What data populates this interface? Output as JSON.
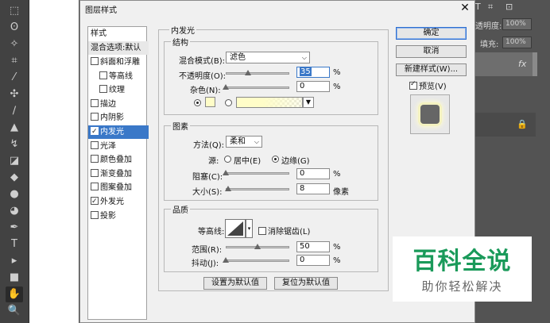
{
  "toolbar": {
    "tools": [
      {
        "name": "marquee-tool-icon",
        "glyph": "⬚"
      },
      {
        "name": "lasso-tool-icon",
        "glyph": "ʘ"
      },
      {
        "name": "magic-wand-tool-icon",
        "glyph": "✧"
      },
      {
        "name": "crop-tool-icon",
        "glyph": "⌗"
      },
      {
        "name": "eyedropper-tool-icon",
        "glyph": "⁄"
      },
      {
        "name": "healing-tool-icon",
        "glyph": "✣"
      },
      {
        "name": "brush-tool-icon",
        "glyph": "∕"
      },
      {
        "name": "stamp-tool-icon",
        "glyph": "▲"
      },
      {
        "name": "history-brush-tool-icon",
        "glyph": "↯"
      },
      {
        "name": "eraser-tool-icon",
        "glyph": "◪"
      },
      {
        "name": "paint-bucket-tool-icon",
        "glyph": "◆"
      },
      {
        "name": "blur-tool-icon",
        "glyph": "●"
      },
      {
        "name": "dodge-tool-icon",
        "glyph": "◕"
      },
      {
        "name": "pen-tool-icon",
        "glyph": "✒"
      },
      {
        "name": "type-tool-icon",
        "glyph": "T"
      },
      {
        "name": "path-select-tool-icon",
        "glyph": "▸"
      },
      {
        "name": "rectangle-tool-icon",
        "glyph": "■"
      },
      {
        "name": "hand-tool-icon",
        "glyph": "✋"
      },
      {
        "name": "zoom-tool-icon",
        "glyph": "🔍"
      }
    ]
  },
  "right_panel": {
    "opacity_label": "透明度:",
    "opacity_value": "100%",
    "fill_label": "填充:",
    "fill_value": "100%",
    "fx_label": "fx"
  },
  "dialog": {
    "title": "图层样式",
    "close": "✕",
    "style_list": {
      "header": "样式",
      "blend_options": "混合选项:默认",
      "items": [
        {
          "label": "斜面和浮雕",
          "checked": false,
          "indent": false
        },
        {
          "label": "等高线",
          "checked": false,
          "indent": true
        },
        {
          "label": "纹理",
          "checked": false,
          "indent": true
        },
        {
          "label": "描边",
          "checked": false,
          "indent": false
        },
        {
          "label": "内阴影",
          "checked": false,
          "indent": false
        },
        {
          "label": "内发光",
          "checked": true,
          "indent": false,
          "selected": true
        },
        {
          "label": "光泽",
          "checked": false,
          "indent": false
        },
        {
          "label": "颜色叠加",
          "checked": false,
          "indent": false
        },
        {
          "label": "渐变叠加",
          "checked": false,
          "indent": false
        },
        {
          "label": "图案叠加",
          "checked": false,
          "indent": false
        },
        {
          "label": "外发光",
          "checked": true,
          "indent": false
        },
        {
          "label": "投影",
          "checked": false,
          "indent": false
        }
      ]
    },
    "inner_glow": {
      "title": "内发光",
      "structure": {
        "title": "结构",
        "blend_mode_label": "混合模式(B):",
        "blend_mode_value": "滤色",
        "opacity_label": "不透明度(O):",
        "opacity_value": "35",
        "opacity_fraction": 0.35,
        "noise_label": "杂色(N):",
        "noise_value": "0",
        "noise_fraction": 0,
        "percent": "%",
        "glow_color": "#fffdc8"
      },
      "elements": {
        "title": "图素",
        "method_label": "方法(Q):",
        "method_value": "柔和",
        "source_label": "源:",
        "center_label": "居中(E)",
        "edge_label": "边缘(G)",
        "choke_label": "阻塞(C):",
        "choke_value": "0",
        "choke_fraction": 0,
        "size_label": "大小(S):",
        "size_value": "8",
        "size_fraction": 0.032,
        "size_unit": "像素",
        "percent": "%"
      },
      "quality": {
        "title": "品质",
        "contour_label": "等高线:",
        "anti_alias_label": "消除锯齿(L)",
        "range_label": "范围(R):",
        "range_value": "50",
        "range_fraction": 0.5,
        "jitter_label": "抖动(J):",
        "jitter_value": "0",
        "jitter_fraction": 0,
        "percent": "%"
      },
      "make_default": "设置为默认值",
      "reset_default": "复位为默认值"
    },
    "buttons": {
      "ok": "确定",
      "cancel": "取消",
      "new_style": "新建样式(W)...",
      "preview_label": "预览(V)"
    }
  },
  "watermark": {
    "title": "百科全说",
    "subtitle": "助你轻松解决"
  }
}
